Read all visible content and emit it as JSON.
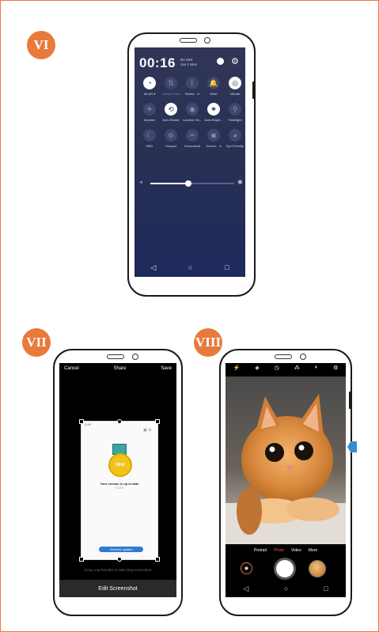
{
  "badges": {
    "vi": "VI",
    "vii": "VII",
    "viii": "VIII"
  },
  "quick_settings": {
    "time": "00:16",
    "carrier": "No SIM",
    "date": "Jan 1 Mon",
    "tiles": [
      {
        "label": "WLAN ▾",
        "icon": "wifi-icon",
        "on": true
      },
      {
        "label": "Cellular Data",
        "icon": "mobile-data-icon",
        "on": false
      },
      {
        "label": "Blueto... ▾",
        "icon": "bluetooth-icon",
        "on": false
      },
      {
        "label": "Mute",
        "icon": "bell-icon",
        "on": false
      },
      {
        "label": "Vibrate",
        "icon": "vibrate-icon",
        "on": true
      },
      {
        "label": "Airplane",
        "icon": "airplane-icon",
        "on": false
      },
      {
        "label": "Auto-Rotate",
        "icon": "rotate-icon",
        "on": true
      },
      {
        "label": "Location Se...",
        "icon": "location-icon",
        "on": false
      },
      {
        "label": "Auto Bright...",
        "icon": "brightness-icon",
        "on": true
      },
      {
        "label": "Flashlight",
        "icon": "flashlight-icon",
        "on": false
      },
      {
        "label": "DND",
        "icon": "moon-icon",
        "on": false
      },
      {
        "label": "Hotspot",
        "icon": "hotspot-icon",
        "on": false
      },
      {
        "label": "Screenshot",
        "icon": "scissors-icon",
        "on": false
      },
      {
        "label": "Screen... ▾",
        "icon": "screen-record-icon",
        "on": false
      },
      {
        "label": "Eye Friendly",
        "icon": "eye-icon",
        "on": false
      }
    ],
    "brightness_level": 0.45
  },
  "screenshot_editor": {
    "cancel": "Cancel",
    "share": "Share",
    "save": "Save",
    "preview_status": "13:06",
    "medal_text": "NEW",
    "update_title": "Your version is up to date",
    "update_version": "V1.0.0",
    "update_button": "Check for updates",
    "hint": "Drag crop handles to take long screenshot",
    "edit": "Edit Screenshot"
  },
  "camera": {
    "modes": [
      "Portrait",
      "Photo",
      "Video",
      "More"
    ],
    "active_mode": "Photo"
  },
  "colors": {
    "accent": "#e87a3b",
    "panel_bg": "#283054",
    "camera_active": "#ef5b4c",
    "arrow": "#2f8fcf"
  }
}
